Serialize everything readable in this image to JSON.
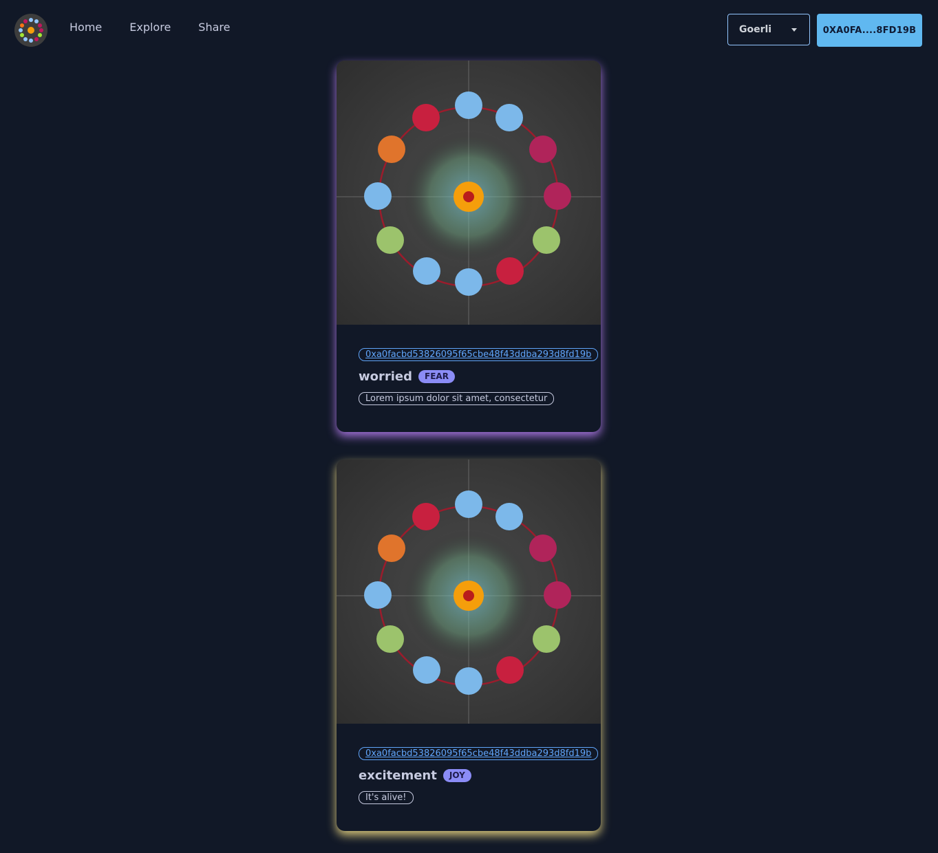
{
  "nav": {
    "logo_alt": "app logo",
    "links": [
      "Home",
      "Explore",
      "Share"
    ],
    "network": "Goerli",
    "wallet": "0XA0FA....8FD19B"
  },
  "cards": [
    {
      "address": "0xa0facbd53826095f65cbe48f43ddba293d8fd19b",
      "feeling": "worried",
      "emotion": "FEAR",
      "message": "Lorem ipsum dolor sit amet, consectetur",
      "glow_color": "#c084fc"
    },
    {
      "address": "0xa0facbd53826095f65cbe48f43ddba293d8fd19b",
      "feeling": "excitement",
      "emotion": "JOY",
      "message": "It's alive!",
      "glow_color": "#fde68a"
    }
  ],
  "colors": {
    "background": "#111827",
    "accent": "#60b8f0",
    "badge": "#8b8cf6"
  }
}
